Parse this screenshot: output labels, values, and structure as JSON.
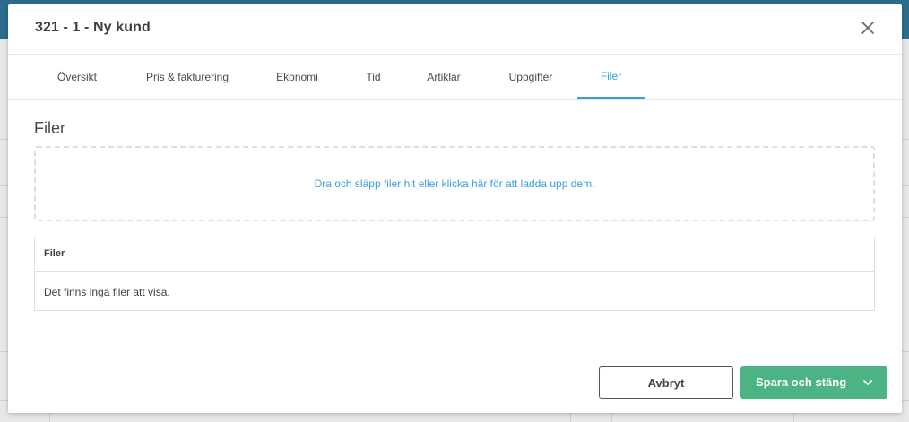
{
  "modal": {
    "title": "321 - 1 - Ny kund",
    "close_icon": "close-icon"
  },
  "tabs": [
    {
      "label": "Översikt",
      "active": false
    },
    {
      "label": "Pris & fakturering",
      "active": false
    },
    {
      "label": "Ekonomi",
      "active": false
    },
    {
      "label": "Tid",
      "active": false
    },
    {
      "label": "Artiklar",
      "active": false
    },
    {
      "label": "Uppgifter",
      "active": false
    },
    {
      "label": "Filer",
      "active": true
    }
  ],
  "files": {
    "section_title": "Filer",
    "dropzone_text": "Dra och släpp filer hit eller klicka här för att ladda upp dem.",
    "table_header": "Filer",
    "empty_text": "Det finns inga filer att visa."
  },
  "footer": {
    "cancel_label": "Avbryt",
    "save_label": "Spara och stäng",
    "save_menu_icon": "chevron-down-icon"
  },
  "colors": {
    "accent": "#3a9fd5",
    "primary_button": "#4cb385",
    "title_text": "#3f3f3f"
  }
}
